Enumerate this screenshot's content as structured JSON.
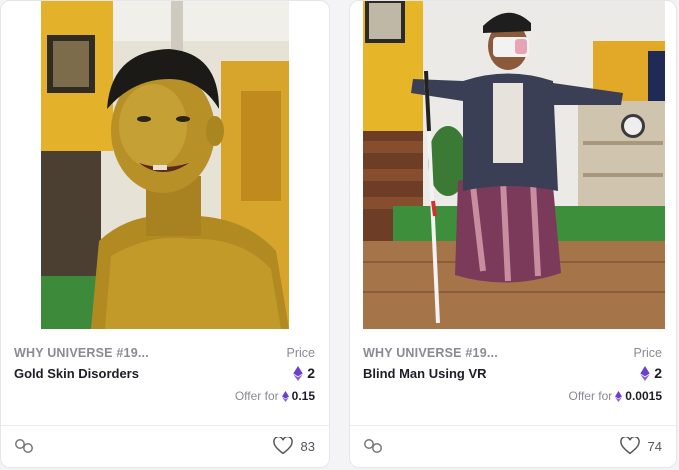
{
  "cards": [
    {
      "collection": "WHY UNIVERSE #19...",
      "name": "Gold Skin Disorders",
      "price_label": "Price",
      "price": "2",
      "offer_label": "Offer for",
      "offer_amount": "0.15",
      "likes": "83",
      "image_alt": "Man with gold glitter painted skin"
    },
    {
      "collection": "WHY UNIVERSE #19...",
      "name": "Blind Man Using VR",
      "price_label": "Price",
      "price": "2",
      "offer_label": "Offer for",
      "offer_amount": "0.0015",
      "likes": "74",
      "image_alt": "Man with white cane wearing VR headset"
    }
  ],
  "colors": {
    "eth_purple": "#6b3fd0",
    "text_dark": "#1d1d26",
    "text_muted": "#8a8a94"
  },
  "icons": [
    "ethereum-icon",
    "chain-link-icon",
    "heart-icon"
  ]
}
